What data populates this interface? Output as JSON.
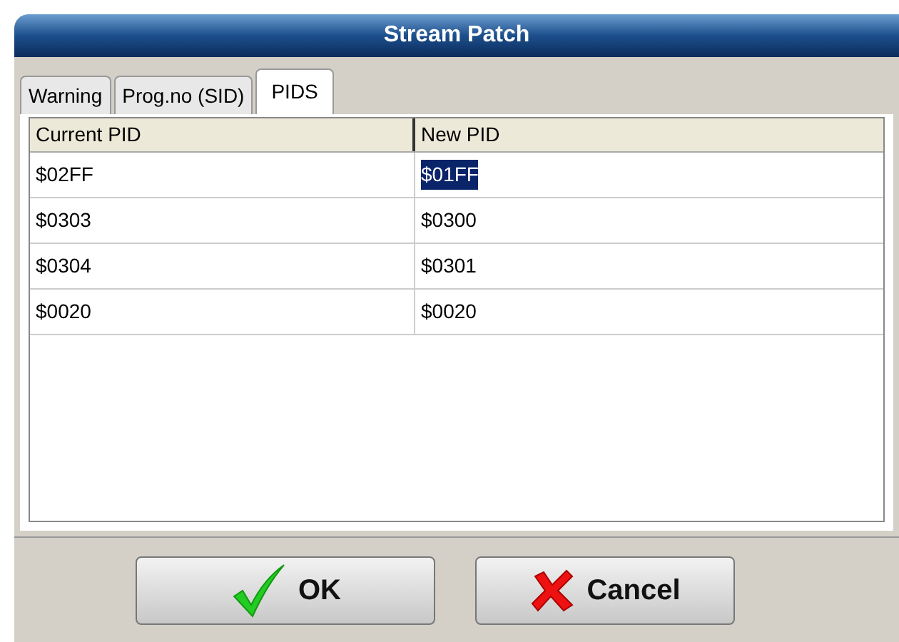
{
  "window": {
    "title": "Stream Patch"
  },
  "tabs": [
    {
      "label": "Warning",
      "selected": false
    },
    {
      "label": "Prog.no (SID)",
      "selected": false
    },
    {
      "label": "PIDS",
      "selected": true
    }
  ],
  "table": {
    "columns": [
      "Current PID",
      "New PID"
    ],
    "rows": [
      {
        "current": "$02FF",
        "new": "$01FF",
        "selected": true
      },
      {
        "current": "$0303",
        "new": "$0300",
        "selected": false
      },
      {
        "current": "$0304",
        "new": "$0301",
        "selected": false
      },
      {
        "current": "$0020",
        "new": "$0020",
        "selected": false
      }
    ]
  },
  "buttons": [
    {
      "kind": "ok",
      "label": "OK"
    },
    {
      "kind": "cancel",
      "label": "Cancel"
    }
  ]
}
